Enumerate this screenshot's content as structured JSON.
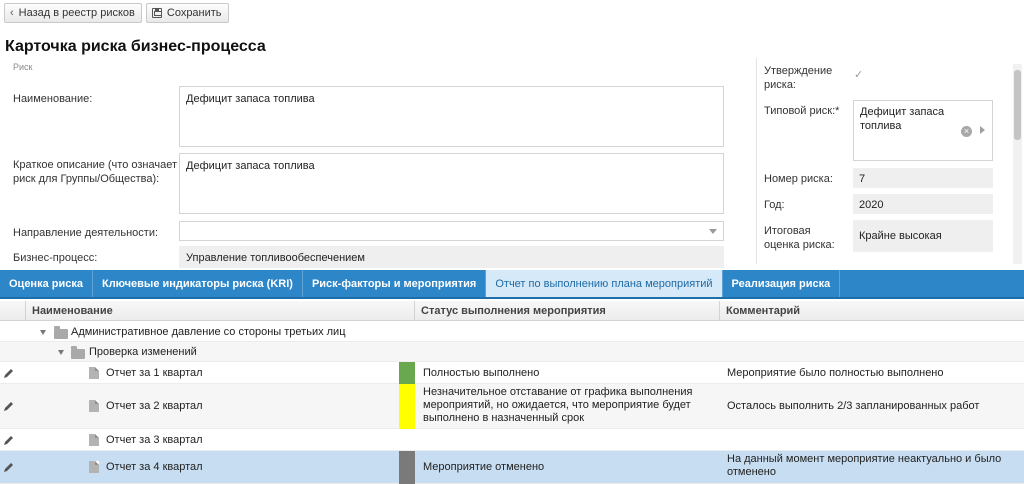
{
  "toolbar": {
    "back_label": "Назад в реестр рисков",
    "save_label": "Сохранить"
  },
  "page_title": "Карточка риска бизнес-процесса",
  "form": {
    "section_label": "Риск",
    "name_label": "Наименование:",
    "name_value": "Дефицит запаса топлива",
    "short_desc_label": "Краткое описание (что означает риск для Группы/Общества):",
    "short_desc_value": "Дефицит запаса топлива",
    "activity_label": "Направление деятельности:",
    "activity_value": "",
    "process_label": "Бизнес-процесс:",
    "process_value": "Управление топливообеспечением"
  },
  "right_panel": {
    "approval_label": "Утверждение риска:",
    "approval_checked": true,
    "typical_risk_label": "Типовой риск:*",
    "typical_risk_value": "Дефицит запаса топлива",
    "risk_number_label": "Номер риска:",
    "risk_number_value": "7",
    "year_label": "Год:",
    "year_value": "2020",
    "total_score_label": "Итоговая оценка риска:",
    "total_score_value": "Крайне высокая"
  },
  "tabs": [
    {
      "label": "Оценка риска",
      "active": false
    },
    {
      "label": "Ключевые индикаторы риска (KRI)",
      "active": false
    },
    {
      "label": "Риск-факторы и мероприятия",
      "active": false
    },
    {
      "label": "Отчет по выполнению плана мероприятий",
      "active": true
    },
    {
      "label": "Реализация риска",
      "active": false
    }
  ],
  "grid": {
    "columns": [
      "Наименование",
      "Статус выполнения мероприятия",
      "Комментарий"
    ],
    "groups": [
      {
        "label": "Административное давление со стороны третьих лиц"
      },
      {
        "label": "Проверка изменений"
      }
    ],
    "rows": [
      {
        "name": "Отчет за 1 квартал",
        "status": "Полностью выполнено",
        "status_color": "#6aa84f",
        "comment": "Мероприятие было полностью выполнено"
      },
      {
        "name": "Отчет за 2 квартал",
        "status": "Незначительное отставание от графика выполнения мероприятий, но ожидается, что мероприятие будет выполнено в назначенный срок",
        "status_color": "#ffff00",
        "comment": "Осталось выполнить 2/3 запланированных работ"
      },
      {
        "name": "Отчет за 3 квартал",
        "status": "",
        "status_color": "",
        "comment": ""
      },
      {
        "name": "Отчет за 4 квартал",
        "status": "Мероприятие отменено",
        "status_color": "#7a7a7a",
        "comment": "На данный момент мероприятие неактуально и было отменено"
      }
    ]
  },
  "colors": {
    "tab_bar": "#2d86c8",
    "active_tab": "#d6e9f8",
    "selected_row": "#c7ddf1"
  },
  "icons": [
    "chevron-left-icon",
    "floppy-disk-icon",
    "checkmark-icon",
    "clear-icon",
    "arrow-right-icon",
    "pencil-icon",
    "expand-triangle-icon",
    "folder-icon",
    "document-icon",
    "dropdown-arrow-icon"
  ]
}
